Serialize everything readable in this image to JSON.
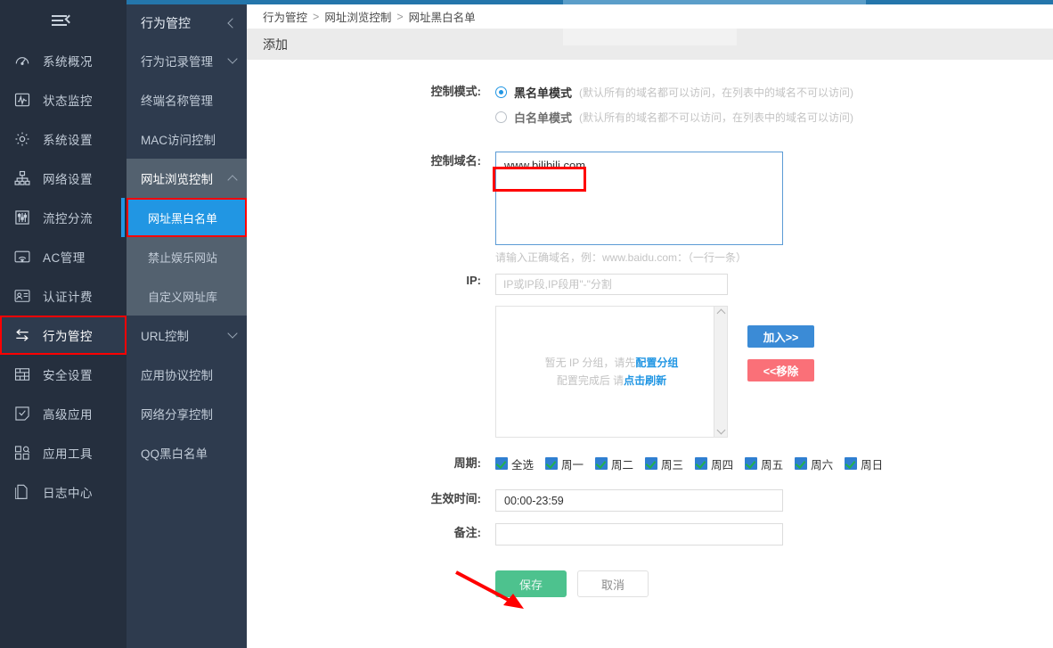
{
  "theme": {
    "sidebar_bg": "#252f3e",
    "submenu_bg": "#2e3b4e",
    "accent_blue": "#2196e3",
    "top_bar": "#2476ab",
    "annotation_red": "#ff0000",
    "save_green": "#4dc28e",
    "add_blue": "#3b8bd6",
    "remove_red": "#fa7078"
  },
  "sidebar": {
    "collapse_icon": "hamburger-collapse-icon",
    "items": [
      {
        "label": "系统概况",
        "icon": "gauge-icon"
      },
      {
        "label": "状态监控",
        "icon": "waveform-monitor-icon"
      },
      {
        "label": "系统设置",
        "icon": "gear-icon"
      },
      {
        "label": "网络设置",
        "icon": "network-tree-icon"
      },
      {
        "label": "流控分流",
        "icon": "sliders-icon"
      },
      {
        "label": "AC管理",
        "icon": "wifi-ac-icon"
      },
      {
        "label": "认证计费",
        "icon": "id-card-icon"
      },
      {
        "label": "行为管控",
        "icon": "arrows-exchange-icon"
      },
      {
        "label": "安全设置",
        "icon": "brick-wall-icon"
      },
      {
        "label": "高级应用",
        "icon": "checklist-icon"
      },
      {
        "label": "应用工具",
        "icon": "apps-grid-icon"
      },
      {
        "label": "日志中心",
        "icon": "documents-icon"
      }
    ],
    "active_index": 7
  },
  "submenu": {
    "title": "行为管控",
    "title_icon": "chevron-left-icon",
    "items": [
      {
        "label": "行为记录管理",
        "icon": "chevron-down-icon",
        "level": 1
      },
      {
        "label": "终端名称管理",
        "icon": "",
        "level": 1
      },
      {
        "label": "MAC访问控制",
        "icon": "",
        "level": 1
      },
      {
        "label": "网址浏览控制",
        "icon": "chevron-up-icon",
        "level": 1,
        "expanded": true
      },
      {
        "label": "网址黑白名单",
        "icon": "",
        "level": 2,
        "selected": true
      },
      {
        "label": "禁止娱乐网站",
        "icon": "",
        "level": 2
      },
      {
        "label": "自定义网址库",
        "icon": "",
        "level": 2
      },
      {
        "label": "URL控制",
        "icon": "chevron-down-icon",
        "level": 1
      },
      {
        "label": "应用协议控制",
        "icon": "",
        "level": 1
      },
      {
        "label": "网络分享控制",
        "icon": "",
        "level": 1
      },
      {
        "label": "QQ黑白名单",
        "icon": "",
        "level": 1
      }
    ]
  },
  "breadcrumb": {
    "items": [
      "行为管控",
      "网址浏览控制",
      "网址黑白名单"
    ],
    "separator": ">"
  },
  "page": {
    "title": "添加"
  },
  "form": {
    "control_mode": {
      "label": "控制模式:",
      "options": [
        {
          "label": "黑名单模式",
          "hint": "(默认所有的域名都可以访问，在列表中的域名不可以访问)",
          "checked": true
        },
        {
          "label": "白名单模式",
          "hint": "(默认所有的域名都不可以访问，在列表中的域名可以访问)",
          "checked": false
        }
      ]
    },
    "domain": {
      "label": "控制域名:",
      "value": "www.bilibili.com",
      "hint": "请输入正确域名，例：www.baidu.com：（一行一条）"
    },
    "ip": {
      "label": "IP:",
      "input_placeholder": "IP或IP段,IP段用\"-\"分割",
      "input_value": "",
      "empty_group_line1_prefix": "暂无 IP 分组，请先",
      "empty_group_link1": "配置分组",
      "empty_group_line2_prefix": "配置完成后 请",
      "empty_group_link2": "点击刷新",
      "add_button": "加入>>",
      "remove_button": "<<移除"
    },
    "period": {
      "label": "周期:",
      "days": [
        {
          "label": "全选",
          "checked": true
        },
        {
          "label": "周一",
          "checked": true
        },
        {
          "label": "周二",
          "checked": true
        },
        {
          "label": "周三",
          "checked": true
        },
        {
          "label": "周四",
          "checked": true
        },
        {
          "label": "周五",
          "checked": true
        },
        {
          "label": "周六",
          "checked": true
        },
        {
          "label": "周日",
          "checked": true
        }
      ]
    },
    "effective_time": {
      "label": "生效时间:",
      "value": "00:00-23:59",
      "placeholder": ""
    },
    "remark": {
      "label": "备注:",
      "value": "",
      "placeholder": ""
    }
  },
  "actions": {
    "save": "保存",
    "cancel": "取消"
  },
  "annotations": {
    "domain_highlight": "red-rect-around-domain-value",
    "sidebar_highlight": "red-rect-around-xingweiguankong",
    "submenu_highlight": "red-rect-around-wangzhi-heibai-mingdan",
    "save_arrow": "red-arrow-pointing-to-save-button"
  }
}
